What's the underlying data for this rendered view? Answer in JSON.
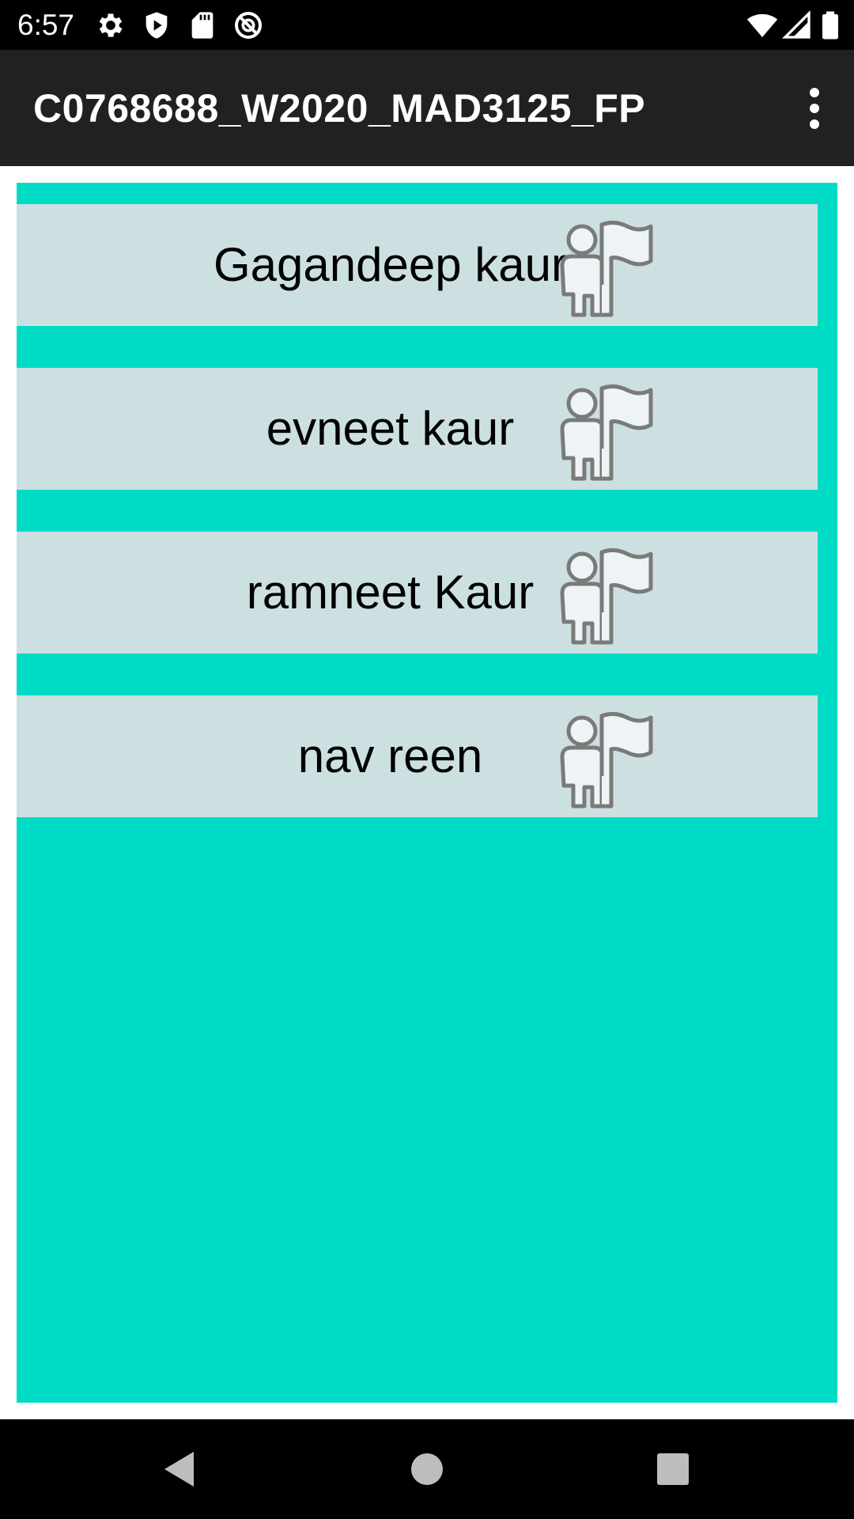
{
  "status_bar": {
    "time": "6:57",
    "left_icons": [
      "settings-icon",
      "shield-play-icon",
      "sd-card-icon",
      "no-disturb-icon"
    ],
    "right_icons": [
      "wifi-icon",
      "signal-icon",
      "battery-icon"
    ]
  },
  "app_bar": {
    "title": "C0768688_W2020_MAD3125_FP",
    "menu_icon": "more-vert-icon"
  },
  "list": {
    "items": [
      {
        "name": "Gagandeep kaur",
        "icon": "person-flag-icon"
      },
      {
        "name": "evneet kaur",
        "icon": "person-flag-icon"
      },
      {
        "name": "ramneet Kaur",
        "icon": "person-flag-icon"
      },
      {
        "name": "nav reen",
        "icon": "person-flag-icon"
      }
    ]
  },
  "nav_bar": {
    "buttons": [
      "back-icon",
      "home-icon",
      "recents-icon"
    ]
  },
  "colors": {
    "status_bar": "#000000",
    "app_bar": "#212121",
    "list_background": "#00dbc5",
    "card_background": "#cde0e1",
    "nav_bar": "#000000"
  }
}
